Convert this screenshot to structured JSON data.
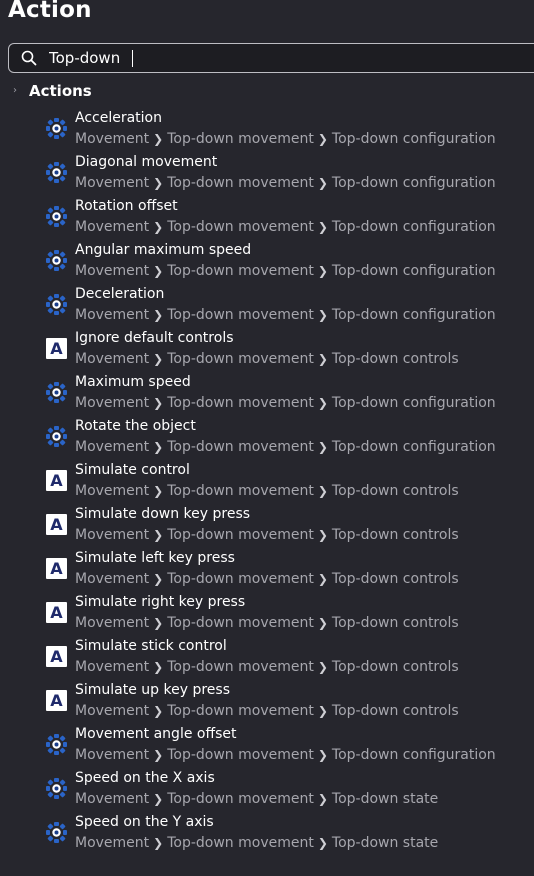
{
  "window_title": "Action",
  "search": {
    "value": "Top-down"
  },
  "group": {
    "label": "Actions"
  },
  "colors": {
    "accent": "#2a64c8",
    "background": "#26262d",
    "path_text": "#a7a7ae"
  },
  "items": [
    {
      "name": "Acceleration",
      "path": [
        "Movement",
        "Top-down movement",
        "Top-down configuration"
      ],
      "icon": "movement-gear-icon"
    },
    {
      "name": "Diagonal movement",
      "path": [
        "Movement",
        "Top-down movement",
        "Top-down configuration"
      ],
      "icon": "movement-gear-icon"
    },
    {
      "name": "Rotation offset",
      "path": [
        "Movement",
        "Top-down movement",
        "Top-down configuration"
      ],
      "icon": "movement-gear-icon"
    },
    {
      "name": "Angular maximum speed",
      "path": [
        "Movement",
        "Top-down movement",
        "Top-down configuration"
      ],
      "icon": "movement-gear-icon"
    },
    {
      "name": "Deceleration",
      "path": [
        "Movement",
        "Top-down movement",
        "Top-down configuration"
      ],
      "icon": "movement-gear-icon"
    },
    {
      "name": "Ignore default controls",
      "path": [
        "Movement",
        "Top-down movement",
        "Top-down controls"
      ],
      "icon": "letter-a-icon"
    },
    {
      "name": "Maximum speed",
      "path": [
        "Movement",
        "Top-down movement",
        "Top-down configuration"
      ],
      "icon": "movement-gear-icon"
    },
    {
      "name": "Rotate the object",
      "path": [
        "Movement",
        "Top-down movement",
        "Top-down configuration"
      ],
      "icon": "movement-gear-icon"
    },
    {
      "name": "Simulate control",
      "path": [
        "Movement",
        "Top-down movement",
        "Top-down controls"
      ],
      "icon": "letter-a-icon"
    },
    {
      "name": "Simulate down key press",
      "path": [
        "Movement",
        "Top-down movement",
        "Top-down controls"
      ],
      "icon": "letter-a-icon"
    },
    {
      "name": "Simulate left key press",
      "path": [
        "Movement",
        "Top-down movement",
        "Top-down controls"
      ],
      "icon": "letter-a-icon"
    },
    {
      "name": "Simulate right key press",
      "path": [
        "Movement",
        "Top-down movement",
        "Top-down controls"
      ],
      "icon": "letter-a-icon"
    },
    {
      "name": "Simulate stick control",
      "path": [
        "Movement",
        "Top-down movement",
        "Top-down controls"
      ],
      "icon": "letter-a-icon"
    },
    {
      "name": "Simulate up key press",
      "path": [
        "Movement",
        "Top-down movement",
        "Top-down controls"
      ],
      "icon": "letter-a-icon"
    },
    {
      "name": "Movement angle offset",
      "path": [
        "Movement",
        "Top-down movement",
        "Top-down configuration"
      ],
      "icon": "movement-gear-icon"
    },
    {
      "name": "Speed on the X axis",
      "path": [
        "Movement",
        "Top-down movement",
        "Top-down state"
      ],
      "icon": "movement-gear-icon"
    },
    {
      "name": "Speed on the Y axis",
      "path": [
        "Movement",
        "Top-down movement",
        "Top-down state"
      ],
      "icon": "movement-gear-icon"
    }
  ]
}
